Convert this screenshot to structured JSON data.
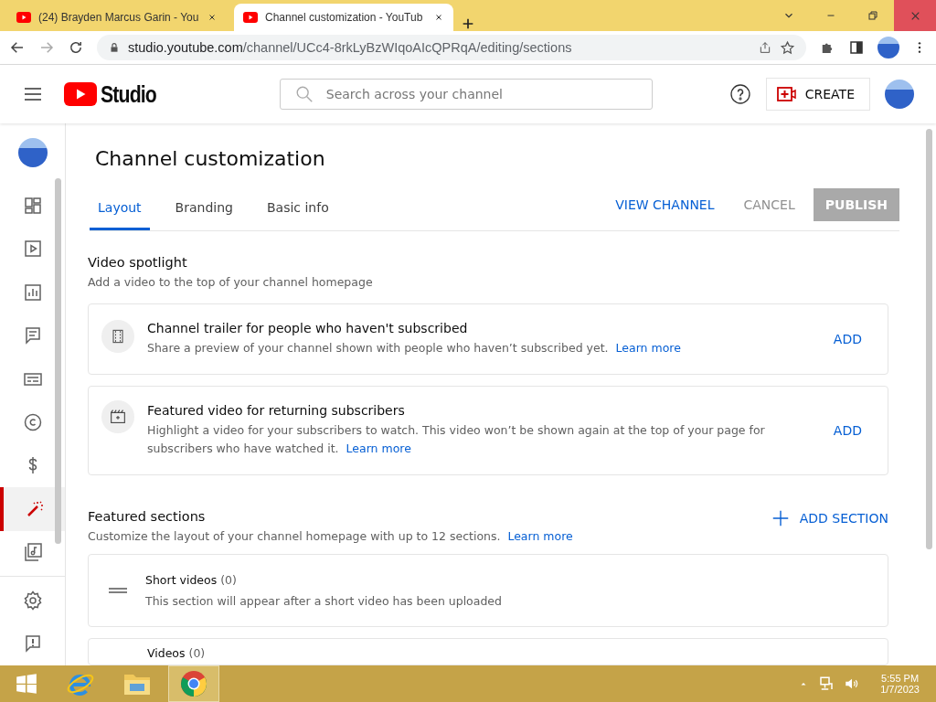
{
  "browser": {
    "tabs": [
      {
        "title": "(24) Brayden Marcus Garin - You",
        "selected": false
      },
      {
        "title": "Channel customization - YouTub",
        "selected": true
      }
    ],
    "url_host": "studio.youtube.com",
    "url_path": "/channel/UCc4-8rkLyBzWIqoAIcQPRqA/editing/sections"
  },
  "header": {
    "logo": "Studio",
    "search": {
      "placeholder": "Search across your channel"
    },
    "create": "CREATE"
  },
  "sidebar": {
    "items": [
      {
        "selected": false
      },
      {
        "selected": false
      },
      {
        "selected": false
      },
      {
        "selected": false
      },
      {
        "selected": false
      },
      {
        "selected": false
      },
      {
        "selected": false
      },
      {
        "selected": true
      },
      {
        "selected": false
      }
    ]
  },
  "page": {
    "title": "Channel customization",
    "tabs": [
      {
        "label": "Layout",
        "selected": true
      },
      {
        "label": "Branding",
        "selected": false
      },
      {
        "label": "Basic info",
        "selected": false
      }
    ],
    "actions": {
      "view": "VIEW CHANNEL",
      "cancel": "CANCEL",
      "publish": "PUBLISH",
      "publish_disabled": true
    }
  },
  "spotlight": {
    "title": "Video spotlight",
    "subtitle": "Add a video to the top of your channel homepage",
    "cards": [
      {
        "kind": "trailer",
        "title": "Channel trailer for people who haven't subscribed",
        "description": "Share a preview of your channel shown with people who haven’t subscribed yet.",
        "link": "Learn more",
        "action": "ADD"
      },
      {
        "kind": "featured",
        "title": "Featured video for returning subscribers",
        "description": "Highlight a video for your subscribers to watch. This video won’t be shown again at the top of your page for subscribers who have watched it.",
        "link": "Learn more",
        "action": "ADD"
      }
    ]
  },
  "sections": {
    "title": "Featured sections",
    "subtitle": "Customize the layout of your channel homepage with up to 12 sections.",
    "link": "Learn more",
    "add": "ADD SECTION",
    "items": [
      {
        "title": "Short videos",
        "count": "(0)",
        "description": "This section will appear after a short video has been uploaded"
      },
      {
        "title": "Videos",
        "count": "(0)"
      }
    ]
  },
  "taskbar": {
    "apps": [
      {
        "kind": "ie",
        "selected": false
      },
      {
        "kind": "explorer",
        "selected": false
      },
      {
        "kind": "chrome",
        "selected": true
      }
    ],
    "time": "5:55 PM",
    "date": "1/7/2023"
  }
}
